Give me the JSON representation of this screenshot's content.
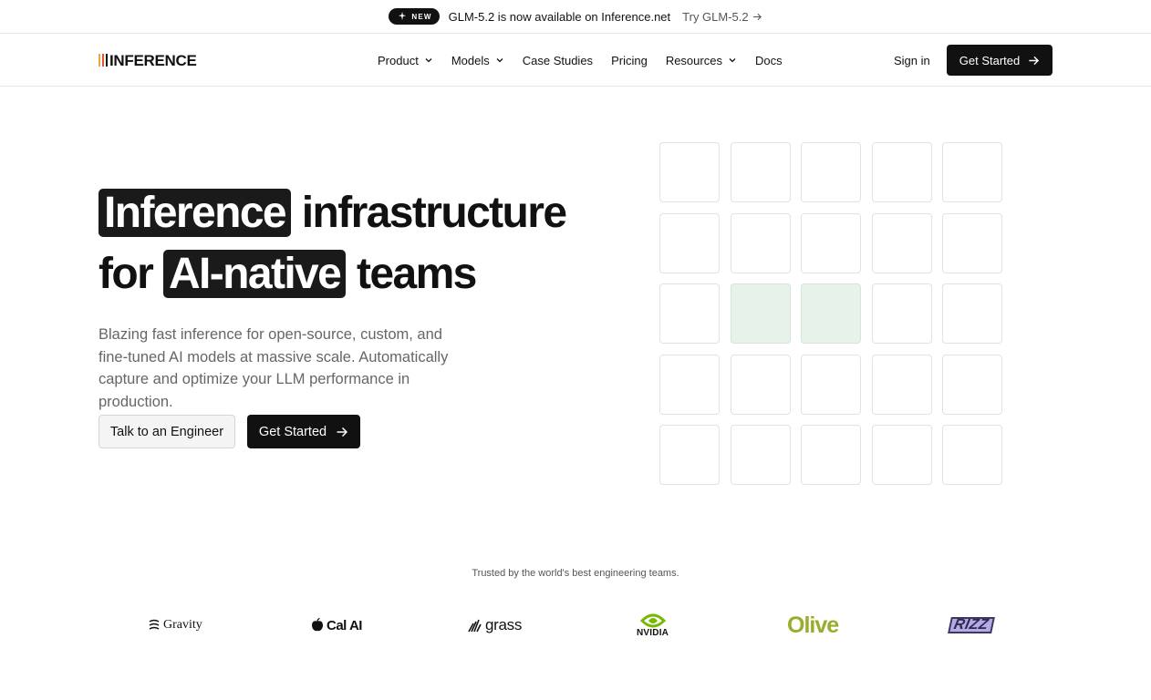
{
  "announcement": {
    "badge": "NEW",
    "text": "GLM-5.2 is now available on Inference.net",
    "link": "Try GLM-5.2"
  },
  "nav": {
    "logo": "INFERENCE",
    "items": [
      {
        "label": "Product",
        "dropdown": true
      },
      {
        "label": "Models",
        "dropdown": true
      },
      {
        "label": "Case Studies",
        "dropdown": false
      },
      {
        "label": "Pricing",
        "dropdown": false
      },
      {
        "label": "Resources",
        "dropdown": true
      },
      {
        "label": "Docs",
        "dropdown": false
      }
    ],
    "signin": "Sign in",
    "cta": "Get Started"
  },
  "hero": {
    "title_hl1": "Inference",
    "title_part2": "infrastructure",
    "title_part3": "for",
    "title_hl2": "AI-native",
    "title_part4": "teams",
    "description": "Blazing fast inference for open-source, custom, and fine-tuned AI models at massive scale. Automatically capture and optimize your LLM performance in production.",
    "secondary_button": "Talk to an Engineer",
    "primary_button": "Get Started"
  },
  "grid": {
    "highlighted_cells": [
      "row3-col2",
      "row3-col3"
    ],
    "highlight_color": "#e7f2e9"
  },
  "trusted": {
    "label": "Trusted by the world's best engineering teams.",
    "logos": [
      "Gravity",
      "Cal AI",
      "grass",
      "NVIDIA",
      "Olive",
      "RIZZ"
    ]
  },
  "colors": {
    "primary": "#111111",
    "text_muted": "#666666",
    "border": "#e5e5e5"
  }
}
